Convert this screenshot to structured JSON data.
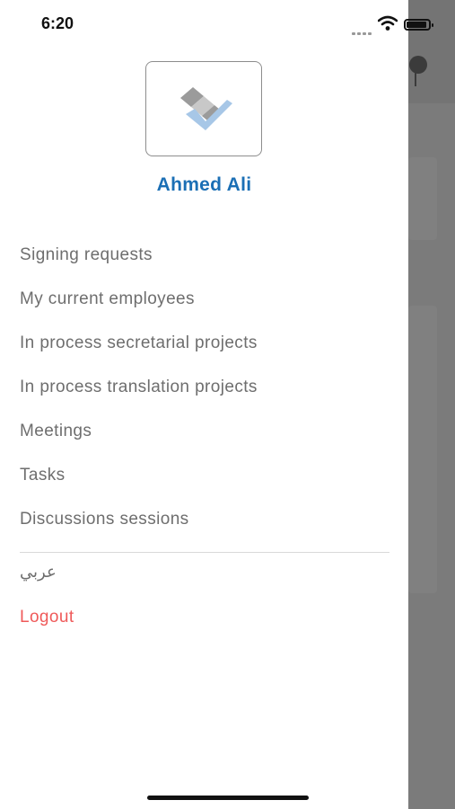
{
  "status_bar": {
    "time": "6:20",
    "icons": [
      "signal-icon",
      "wifi-icon",
      "battery-icon"
    ]
  },
  "profile": {
    "logo": "company-logo-icon",
    "name": "Ahmed Ali",
    "name_color": "#1b6fb5"
  },
  "menu": {
    "items": [
      {
        "label": "Signing requests"
      },
      {
        "label": "My current employees"
      },
      {
        "label": "In process secretarial projects"
      },
      {
        "label": "In process translation projects"
      },
      {
        "label": "Meetings"
      },
      {
        "label": "Tasks"
      },
      {
        "label": "Discussions sessions"
      }
    ],
    "language_label": "عربي",
    "logout_label": "Logout",
    "logout_color": "#ef5a5a"
  }
}
